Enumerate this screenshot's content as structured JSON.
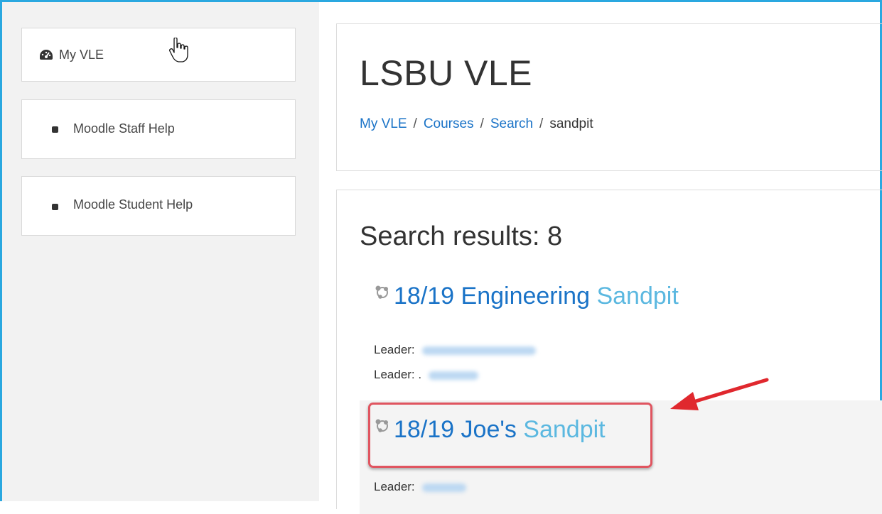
{
  "sidebar": {
    "items": [
      {
        "label": "My VLE",
        "icon": "dashboard-icon"
      },
      {
        "label": "Moodle Staff Help",
        "icon": "bullet-icon"
      },
      {
        "label": "Moodle Student Help",
        "icon": "bullet-icon"
      }
    ]
  },
  "header": {
    "site_title": "LSBU VLE",
    "breadcrumb": [
      {
        "label": "My VLE"
      },
      {
        "label": "Courses"
      },
      {
        "label": "Search"
      },
      {
        "label": "sandpit"
      }
    ],
    "separator": "/"
  },
  "results": {
    "title": "Search results: 8",
    "courses": [
      {
        "name_prefix": "18/19 Engineering",
        "name_highlight": "Sandpit",
        "leaders": [
          "Leader:",
          "Leader: ."
        ]
      },
      {
        "name_prefix": "18/19 Joe's",
        "name_highlight": "Sandpit",
        "leaders": [
          "Leader:"
        ]
      }
    ]
  },
  "colors": {
    "accent_frame": "#2aa8e0",
    "link": "#1a73c7",
    "search_highlight": "#5bb8e0",
    "annotation": "#e05560"
  }
}
